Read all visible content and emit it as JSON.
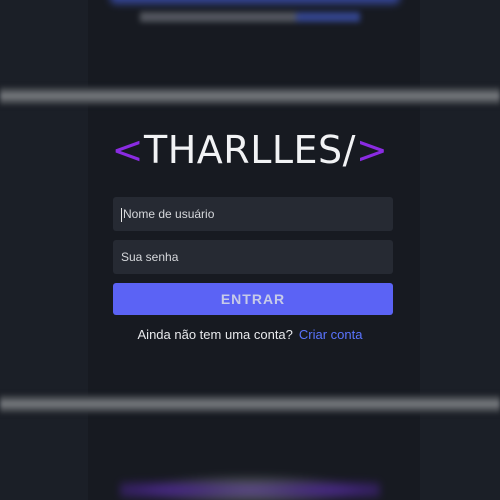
{
  "logo": {
    "open": "<",
    "name": "THARLLES/",
    "close": ">",
    "bracket_color": "#8a2be2"
  },
  "form": {
    "username_placeholder": "Nome de usuário",
    "password_placeholder": "Sua senha",
    "submit_label": "ENTRAR",
    "accent_color": "#5b63f5"
  },
  "signup": {
    "prompt": "Ainda não tem uma conta?",
    "link": "Criar conta"
  }
}
